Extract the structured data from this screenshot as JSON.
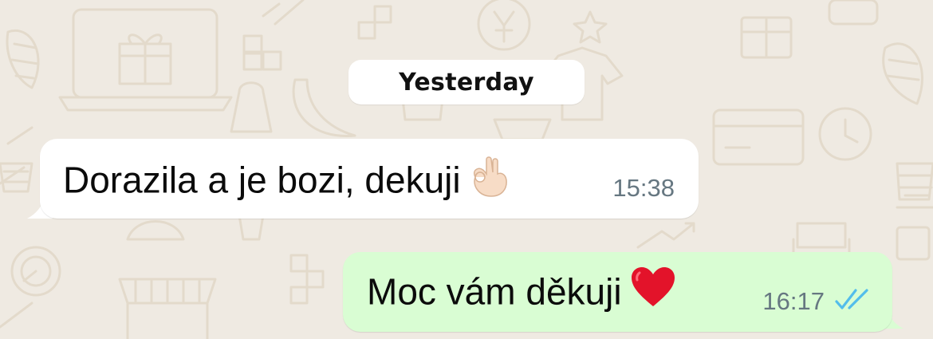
{
  "chat": {
    "date_separator": "Yesterday",
    "messages": [
      {
        "direction": "incoming",
        "text": "Dorazila a je bozi, dekuji",
        "emoji": "ok-hand-emoji",
        "time": "15:38"
      },
      {
        "direction": "outgoing",
        "text": "Moc vám děkuji",
        "emoji": "red-heart-emoji",
        "time": "16:17",
        "status": "read"
      }
    ]
  },
  "colors": {
    "background": "#efeae2",
    "incoming_bubble": "#ffffff",
    "outgoing_bubble": "#d9fdd3",
    "timestamp": "#667781",
    "read_ticks": "#53bdeb"
  }
}
